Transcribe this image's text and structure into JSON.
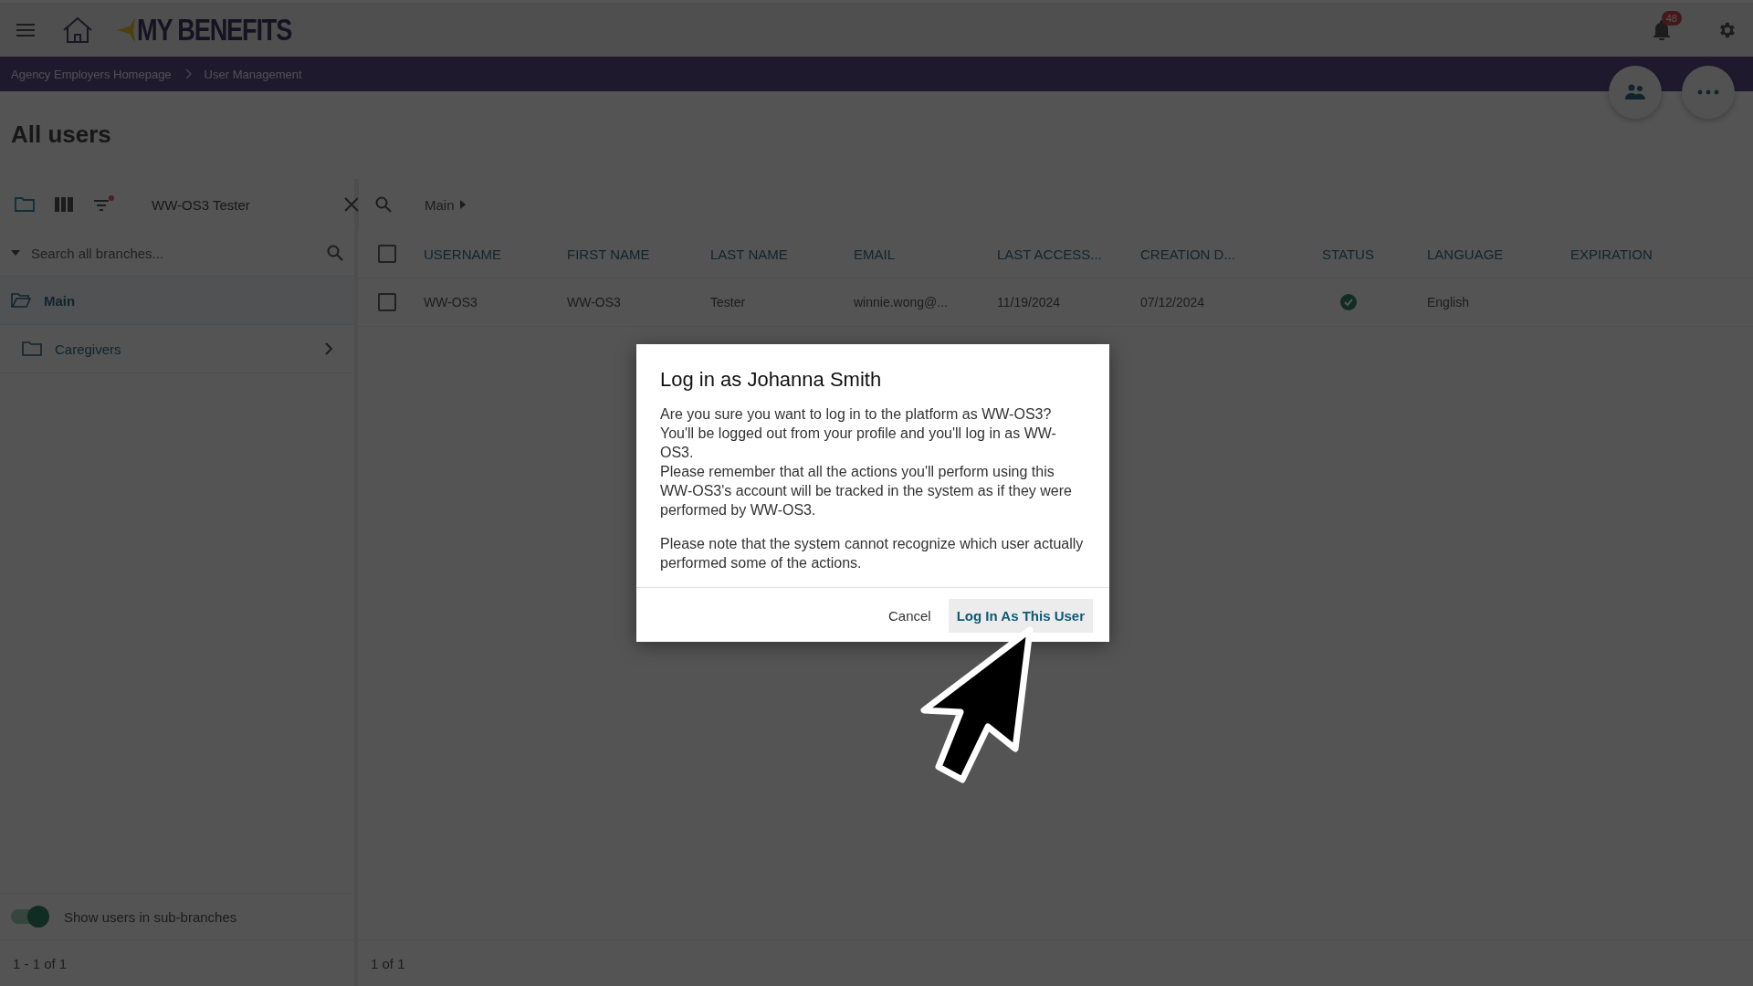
{
  "header": {
    "logo": "MY BENEFITS",
    "notifications": "48"
  },
  "breadcrumbs": [
    "Agency Employers Homepage",
    "User Management"
  ],
  "page_title": "All users",
  "toolbar": {
    "filter_active": true,
    "search_value": "WW-OS3 Tester",
    "branch": "Main"
  },
  "sidebar": {
    "search_placeholder": "Search all branches...",
    "items": [
      {
        "label": "Main",
        "selected": true,
        "expandable": false
      },
      {
        "label": "Caregivers",
        "selected": false,
        "expandable": true
      }
    ],
    "toggle": {
      "label": "Show users in sub-branches",
      "on": true
    },
    "pagination": "1 - 1 of 1"
  },
  "table": {
    "select_all_checked": false,
    "columns": [
      "USERNAME",
      "FIRST NAME",
      "LAST NAME",
      "EMAIL",
      "LAST ACCESS...",
      "CREATION D...",
      "STATUS",
      "LANGUAGE",
      "EXPIRATION"
    ],
    "rows": [
      {
        "checked": false,
        "username": "WW-OS3",
        "first_name": "WW-OS3",
        "last_name": "Tester",
        "email": "winnie.wong@...",
        "last_access": "11/19/2024",
        "creation_date": "07/12/2024",
        "status_active": true,
        "language": "English",
        "expiration": ""
      }
    ],
    "pagination": "1 of 1"
  },
  "dialog": {
    "title": "Log in as Johanna Smith",
    "paragraphs": [
      "Are you sure you want to log in to the platform as WW-OS3? You'll be logged out from your profile and you'll log in as WW-OS3.\nPlease remember that all the actions you'll perform using this WW-OS3's account will be tracked in the system as if they were performed by WW-OS3.",
      "Please note that the system cannot recognize which user actually performed some of the actions."
    ],
    "buttons": [
      {
        "label": "Cancel",
        "kind": "plain",
        "hovered": false
      },
      {
        "label": "Log In As This User",
        "kind": "accent",
        "hovered": true
      }
    ]
  }
}
